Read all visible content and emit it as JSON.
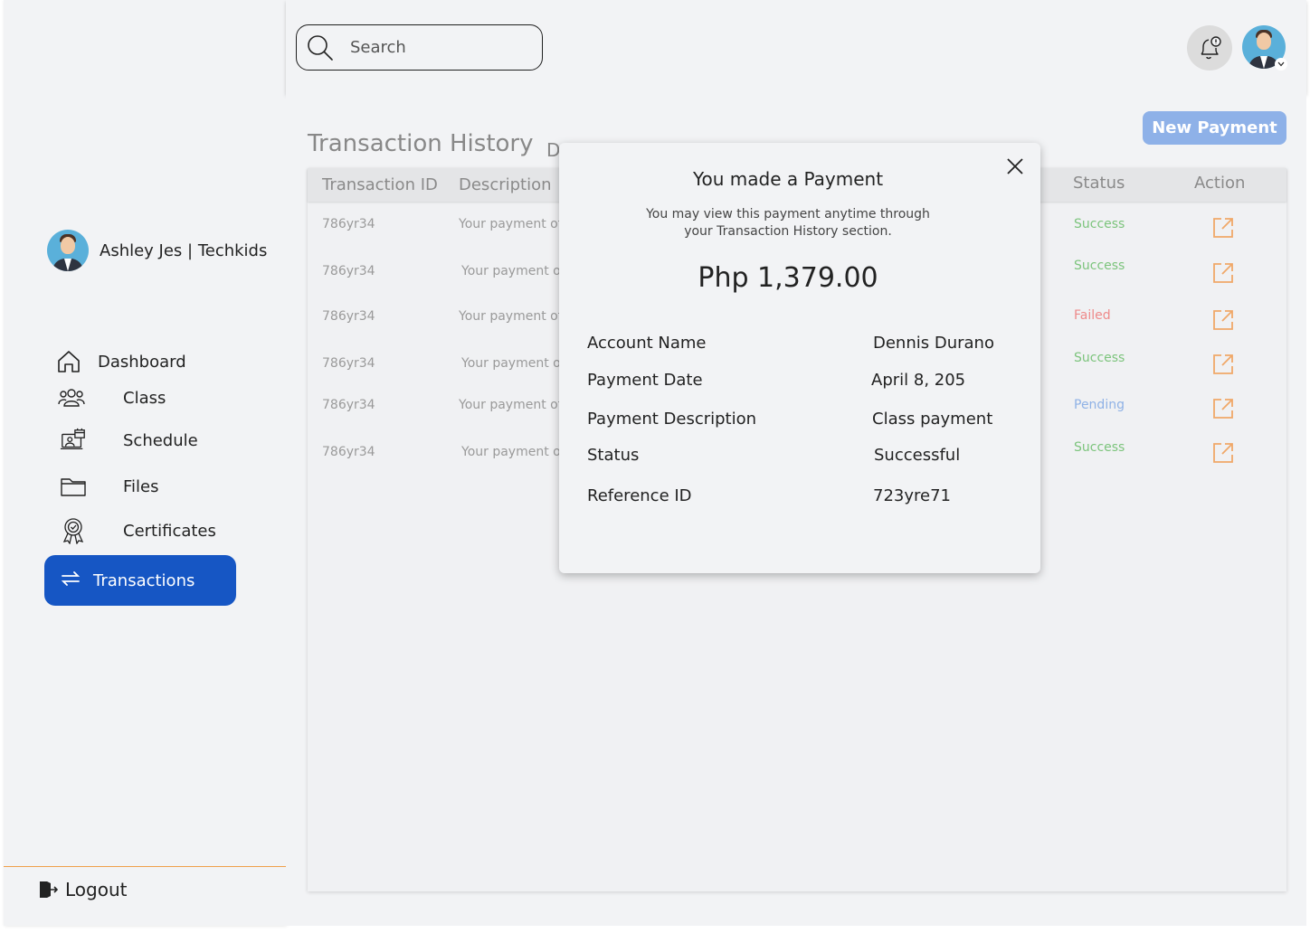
{
  "user": {
    "name": "Ashley Jes | Techkids"
  },
  "search": {
    "placeholder": "Search"
  },
  "sidebar": {
    "items": [
      {
        "label": "Dashboard",
        "icon": "home-icon"
      },
      {
        "label": "Class",
        "icon": "users-icon"
      },
      {
        "label": "Schedule",
        "icon": "schedule-icon"
      },
      {
        "label": "Files",
        "icon": "folder-icon"
      },
      {
        "label": "Certificates",
        "icon": "certificate-icon"
      },
      {
        "label": "Transactions",
        "icon": "transfer-icon",
        "active": true
      }
    ],
    "logout": "Logout"
  },
  "main": {
    "title": "Transaction History",
    "subtitle_partial": "D",
    "new_payment": "New Payment",
    "table": {
      "headers": [
        "Transaction ID",
        "Description",
        "Status",
        "Action"
      ],
      "rows": [
        {
          "id": "786yr34",
          "description": "Your payment of",
          "status": "Success"
        },
        {
          "id": "786yr34",
          "description": "Your payment o",
          "status": "Success"
        },
        {
          "id": "786yr34",
          "description": "Your payment of",
          "status": "Failed"
        },
        {
          "id": "786yr34",
          "description": "Your payment o",
          "status": "Success"
        },
        {
          "id": "786yr34",
          "description": "Your payment of",
          "status": "Pending"
        },
        {
          "id": "786yr34",
          "description": "Your payment o",
          "status": "Success"
        }
      ]
    }
  },
  "modal": {
    "title": "You made a Payment",
    "message": "You may view this payment anytime through your Transaction History section.",
    "amount": "Php 1,379.00",
    "details": {
      "account_name_label": "Account Name",
      "account_name": "Dennis Durano",
      "payment_date_label": "Payment Date",
      "payment_date": "April 8, 205",
      "payment_description_label": "Payment Description",
      "payment_description": "Class payment",
      "status_label": "Status",
      "status": "Successful",
      "reference_id_label": "Reference ID",
      "reference_id": "723yre71"
    }
  },
  "colors": {
    "primary": "#1656c4",
    "new_payment_bg": "#8eb1e8",
    "success": "#7cc47c",
    "failed": "#ee8a8a",
    "pending": "#8fb2e6",
    "action_icon": "#f0a868",
    "logout_separator": "#f0a04a"
  }
}
